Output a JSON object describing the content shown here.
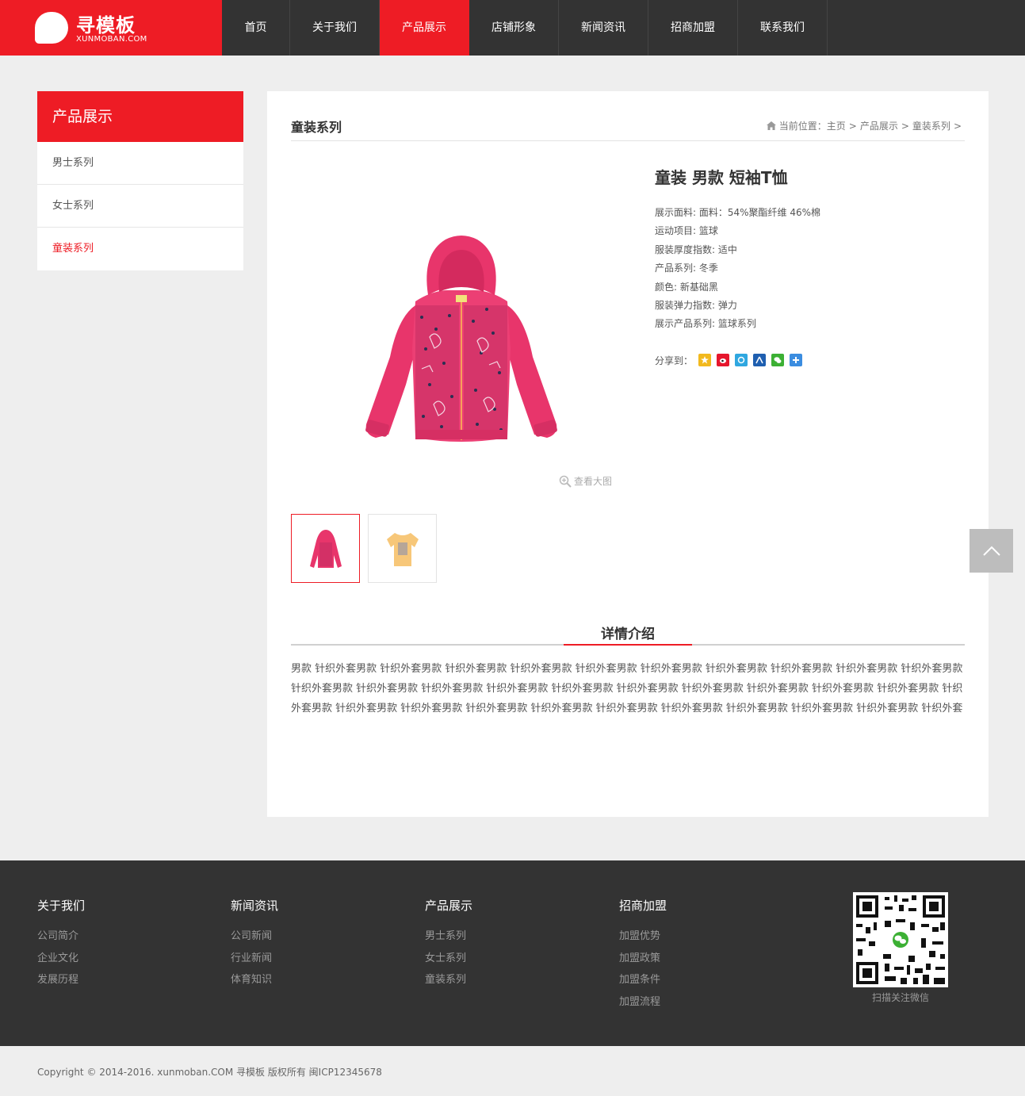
{
  "header": {
    "logo_name": "寻模板",
    "logo_sub": "XUNMOBAN.COM",
    "nav": [
      "首页",
      "关于我们",
      "产品展示",
      "店铺形象",
      "新闻资讯",
      "招商加盟",
      "联系我们"
    ]
  },
  "sidebar": {
    "title": "产品展示",
    "items": [
      "男士系列",
      "女士系列",
      "童装系列"
    ]
  },
  "main": {
    "title": "童装系列",
    "breadcrumb": [
      "当前位置：主页",
      ">",
      "产品展示",
      ">",
      "童装系列",
      ">"
    ],
    "product_title": "童装 男款 短袖T恤",
    "specs": [
      "展示面料: 面料：54%聚酯纤维 46%棉",
      "运动项目: 篮球",
      "服装厚度指数: 适中",
      "产品系列: 冬季",
      "颜色: 新基础黑",
      "服装弹力指数: 弹力",
      "展示产品系列: 篮球系列"
    ],
    "share_label": "分享到：",
    "zoom_label": "查看大图",
    "detail_title": "详情介绍",
    "detail_body": "男款 针织外套男款 针织外套男款 针织外套男款 针织外套男款 针织外套男款 针织外套男款 针织外套男款 针织外套男款 针织外套男款 针织外套男款 针织外套男款 针织外套男款 针织外套男款 针织外套男款 针织外套男款 针织外套男款 针织外套男款 针织外套男款 针织外套男款 针织外套男款 针织外套男款 针织外套男款 针织外套男款 针织外套男款 针织外套男款 针织外套男款 针织外套男款 针织外套男款 针织外套男款 针织外套男款 针织外套"
  },
  "footer": {
    "columns": [
      {
        "title": "关于我们",
        "links": [
          "公司简介",
          "企业文化",
          "发展历程"
        ]
      },
      {
        "title": "新闻资讯",
        "links": [
          "公司新闻",
          "行业新闻",
          "体育知识"
        ]
      },
      {
        "title": "产品展示",
        "links": [
          "男士系列",
          "女士系列",
          "童装系列"
        ]
      },
      {
        "title": "招商加盟",
        "links": [
          "加盟优势",
          "加盟政策",
          "加盟条件",
          "加盟流程"
        ]
      }
    ],
    "qr_caption": "扫描关注微信",
    "copyright": "Copyright © 2014-2016. xunmoban.COM 寻模板 版权所有   闽ICP12345678"
  },
  "colors": {
    "brand": "#ee1c25",
    "dark": "#333333",
    "bg": "#eeeeee"
  }
}
